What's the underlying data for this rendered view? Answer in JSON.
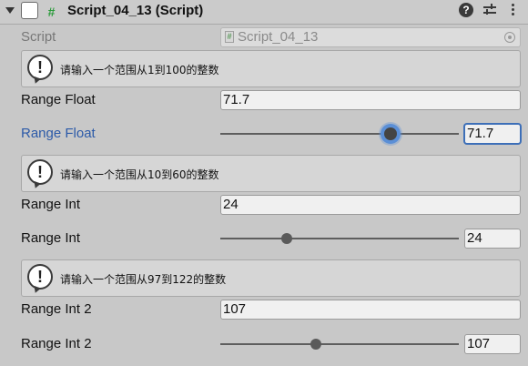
{
  "header": {
    "title": "Script_04_13 (Script)",
    "icons": [
      "fold-arrow-icon",
      "script-icon",
      "help-icon",
      "presets-icon",
      "context-menu-icon"
    ]
  },
  "script_field": {
    "label": "Script",
    "value": "Script_04_13"
  },
  "groups": [
    {
      "help_text": "请输入一个范围从1到100的整数",
      "field_label": "Range Float",
      "field_value": "71.7",
      "slider_label": "Range Float",
      "slider_value": "71.7",
      "slider_min": 1,
      "slider_max": 100,
      "slider_fraction": 0.714
    },
    {
      "help_text": "请输入一个范围从10到60的整数",
      "field_label": "Range Int",
      "field_value": "24",
      "slider_label": "Range Int",
      "slider_value": "24",
      "slider_min": 10,
      "slider_max": 60,
      "slider_fraction": 0.28
    },
    {
      "help_text": "请输入一个范围从97到122的整数",
      "field_label": "Range Int 2",
      "field_value": "107",
      "slider_label": "Range Int 2",
      "slider_value": "107",
      "slider_min": 97,
      "slider_max": 122,
      "slider_fraction": 0.4
    }
  ],
  "colors": {
    "focus_blue": "#2c5aa8",
    "script_green": "#2a9b3a"
  }
}
